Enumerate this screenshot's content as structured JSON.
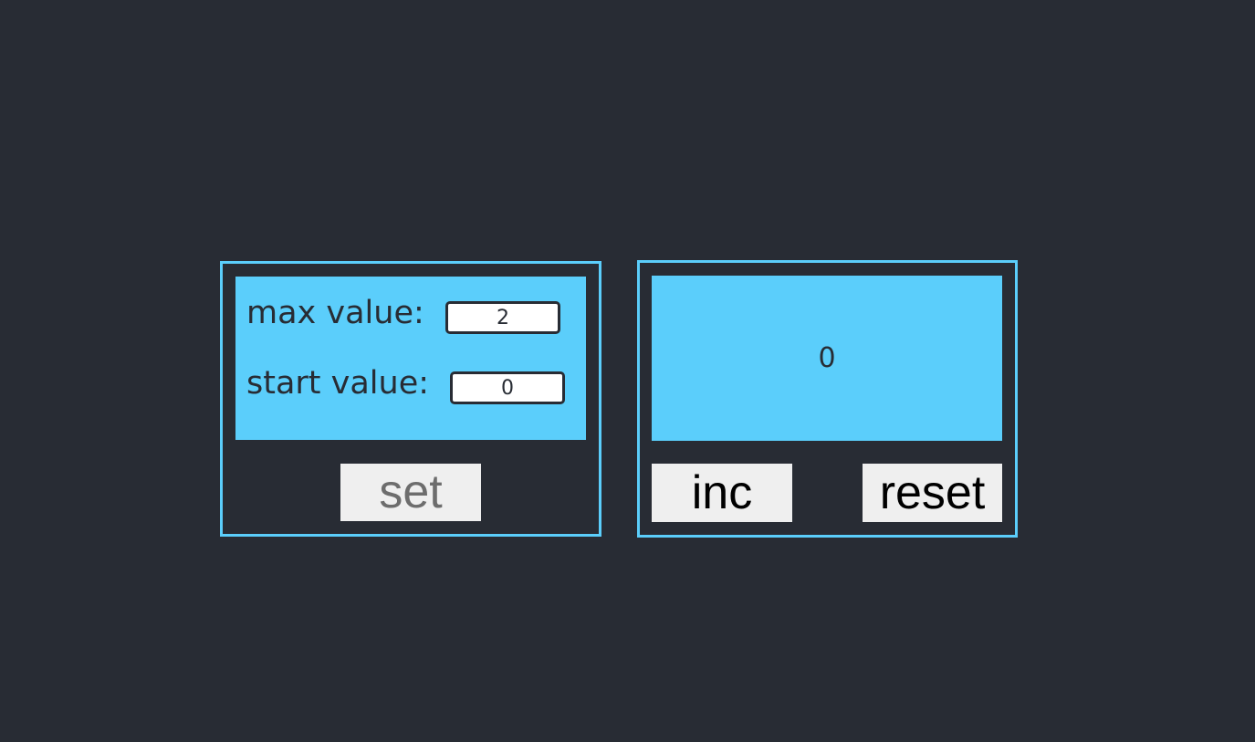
{
  "settings": {
    "max_label": "max value:",
    "max_value": "2",
    "start_label": "start value:",
    "start_value": "0",
    "set_label": "set"
  },
  "counter": {
    "display_value": "0",
    "inc_label": "inc",
    "reset_label": "reset"
  },
  "colors": {
    "background": "#282c34",
    "accent": "#5bcefb",
    "button_bg": "#efefef",
    "disabled_text": "#6d6d6d"
  }
}
